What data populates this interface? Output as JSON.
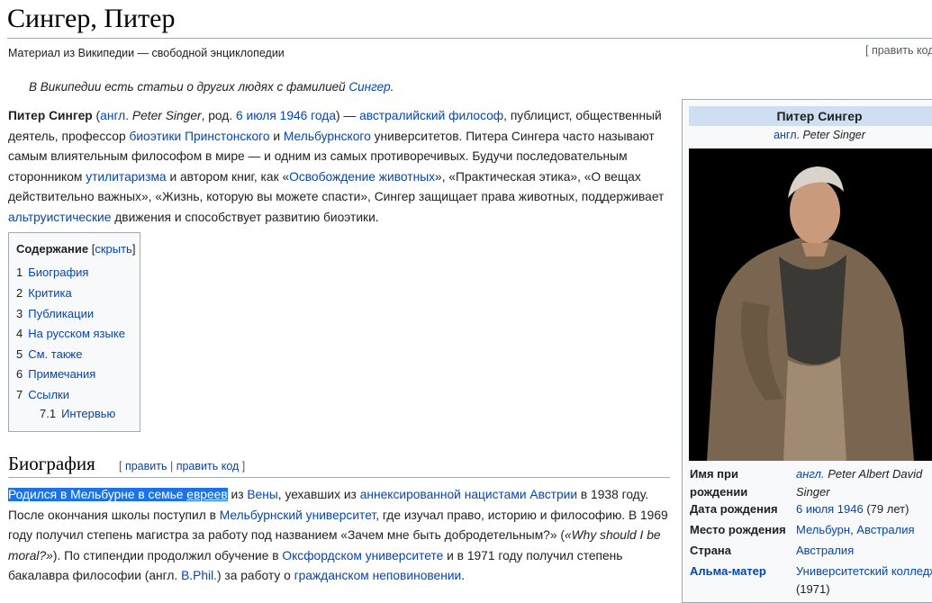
{
  "page": {
    "title": "Сингер, Питер",
    "from": "Материал из Википедии — свободной энциклопедии",
    "edit_source": "[ править код ]",
    "hatnote_prefix": "В Википедии есть статьи о других людях с фамилией ",
    "hatnote_link": "Сингер",
    "hatnote_suffix": "."
  },
  "lead": {
    "s1": "Питер Сингер",
    "s2": " (",
    "s3": "англ.",
    "s4": " Peter Singer",
    "s5": ", род. ",
    "s6": "6 июля 1946 года",
    "s7": ") — ",
    "s8": "австралийский",
    "s9": " ",
    "s10": "философ",
    "s11": ", публицист, общественный деятель, профессор ",
    "s12": "биоэтики",
    "s13": " ",
    "s14": "Принстонского",
    "s15": " и ",
    "s16": "Мельбурнского",
    "s17": " университетов. Питера Сингера часто называют самым влиятельным философом в мире — и одним из самых противоречивых. Будучи последовательным сторонником ",
    "s18": "утилитаризма",
    "s19": " и автором книг, как «",
    "s20": "Освобождение животных",
    "s21": "», «Практическая этика», «О вещах действительно важных», «Жизнь, которую вы можете спасти», Сингер защищает права животных, поддерживает ",
    "s22": "альтруистические",
    "s23": " движения и способствует развитию биоэтики."
  },
  "toc": {
    "heading": "Содержание",
    "hide": "скрыть",
    "items": [
      {
        "num": "1",
        "label": "Биография"
      },
      {
        "num": "2",
        "label": "Критика"
      },
      {
        "num": "3",
        "label": "Публикации"
      },
      {
        "num": "4",
        "label": "На русском языке"
      },
      {
        "num": "5",
        "label": "См. также"
      },
      {
        "num": "6",
        "label": "Примечания"
      },
      {
        "num": "7",
        "label": "Ссылки"
      },
      {
        "num": "7.1",
        "label": "Интервью"
      }
    ]
  },
  "bio": {
    "heading": "Биография",
    "edit": "править",
    "edit_code": "править код",
    "b1": "Родился в Мельбурне в семье ",
    "b2": "евреев",
    "b3": " из ",
    "b4": "Вены",
    "b5": ", уехавших из ",
    "b6": "аннексированной нацистами Австрии",
    "b7": " в 1938 году. После окончания школы поступил в ",
    "b8": "Мельбурнский университет",
    "b9": ", где изучал право, историю и философию. В 1969 году получил степень магистра за работу под названием «Зачем мне быть добродетельным?» (",
    "b10": "«Why should I be moral?»",
    "b11": "). По стипендии продолжил обучение в ",
    "b12": "Оксфордском университете",
    "b13": " и в 1971 году получил степень бакалавра философии (англ. ",
    "b14": "B.Phil.",
    "b15": ") за работу о ",
    "b16": "гражданском неповиновении",
    "b17": "."
  },
  "infobox": {
    "title": "Питер Сингер",
    "sub_lang": "англ.",
    "sub_name": " Peter Singer",
    "rows": [
      {
        "label": "Имя при рождении",
        "v1": "англ.",
        "v2": " Peter Albert David",
        "v3": "Singer"
      },
      {
        "label": "Дата рождения",
        "v1": "6 июля 1946",
        "v2": " (79 лет)"
      },
      {
        "label": "Место рождения",
        "v1": "Мельбурн",
        "v2": ", ",
        "v3": "Австралия"
      },
      {
        "label": "Страна",
        "v1": "Австралия"
      },
      {
        "label": "Альма-матер",
        "v1": "Университетский колледж",
        "v2": "(1971)"
      }
    ]
  },
  "colors": {
    "link": "#0645ad",
    "selection": "#1a73e8",
    "infobox_header": "#cedff2"
  }
}
